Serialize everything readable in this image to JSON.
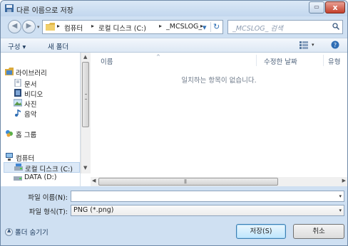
{
  "window": {
    "title": "다른 이름으로 저장",
    "close_label": "x",
    "restore_label": "▭"
  },
  "address": {
    "crumbs": [
      "컴퓨터",
      "로컬 디스크 (C:)",
      "_MCSLOG_"
    ],
    "search_placeholder": "_MCSLOG_ 검색"
  },
  "toolbar": {
    "organize_label": "구성 ▾",
    "new_folder_label": "새 폴더"
  },
  "nav": {
    "items": [
      {
        "label": "라이브러리",
        "icon": "library-icon"
      },
      {
        "label": "문서",
        "icon": "documents-icon"
      },
      {
        "label": "비디오",
        "icon": "video-icon"
      },
      {
        "label": "사진",
        "icon": "pictures-icon"
      },
      {
        "label": "음악",
        "icon": "music-icon"
      },
      {
        "label": "홈 그룹",
        "icon": "homegroup-icon"
      },
      {
        "label": "컴퓨터",
        "icon": "computer-icon"
      },
      {
        "label": "로컬 디스크 (C:)",
        "icon": "drive-icon"
      },
      {
        "label": "DATA (D:)",
        "icon": "drive-icon"
      }
    ],
    "selected": "로컬 디스크 (C:)"
  },
  "files": {
    "columns": [
      "이름",
      "수정한 날짜",
      "유형"
    ],
    "empty_message": "일치하는 항목이 없습니다."
  },
  "scrollbar": {
    "grip": "|||"
  },
  "form": {
    "filename_label": "파일 이름(N):",
    "filename_value": "",
    "filetype_label": "파일 형식(T):",
    "filetype_value": "PNG (*.png)"
  },
  "footer": {
    "hide_folders_label": "폴더 숨기기",
    "save_label": "저장(S)",
    "cancel_label": "취소"
  },
  "colors": {
    "titlebar": "#c2d7ee",
    "selection": "#dce9f7",
    "close": "#c4402c"
  }
}
